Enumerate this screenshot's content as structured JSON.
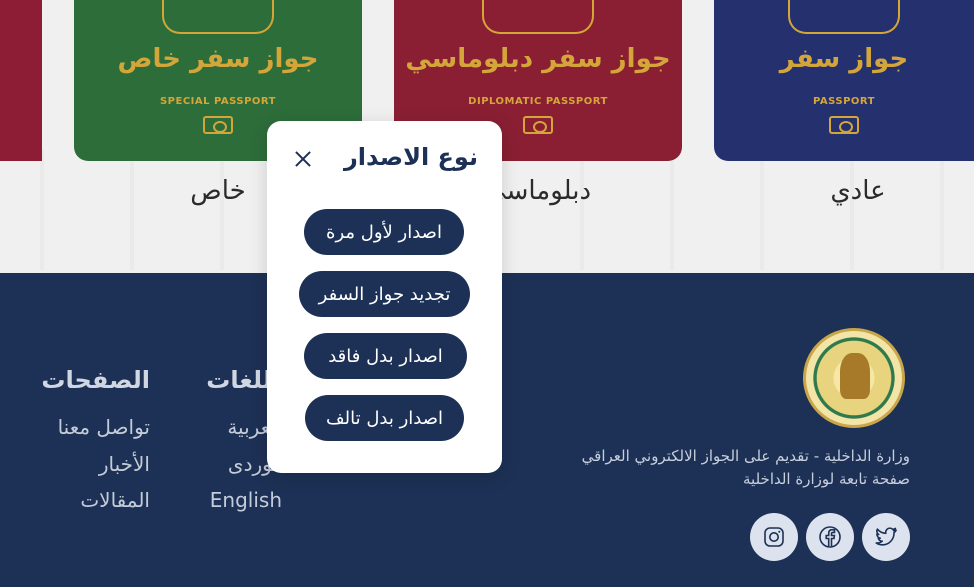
{
  "passports": [
    {
      "arabic": "جواز سفر خاص",
      "english": "SPECIAL PASSPORT",
      "caption": "خاص",
      "color": "#2d6d3a"
    },
    {
      "arabic": "جواز سفر دبلوماسي",
      "english": "DIPLOMATIC PASSPORT",
      "caption": "دبلوماسي",
      "color": "#8a1f33"
    },
    {
      "arabic": "جواز سفر",
      "english": "PASSPORT",
      "caption": "عادي",
      "color": "#25306e"
    }
  ],
  "modal": {
    "title": "نوع الاصدار",
    "options": [
      "اصدار لأول مرة",
      "تجديد جواز السفر",
      "اصدار بدل فاقد",
      "اصدار بدل تالف"
    ]
  },
  "footer": {
    "org_line_1": "وزارة الداخلية - تقديم على الجواز الالكتروني العراقي",
    "org_line_2": "صفحة تابعة لوزارة الداخلية",
    "pages_heading": "الصفحات",
    "pages": [
      "تواصل معنا",
      "الأخبار",
      "المقالات"
    ],
    "languages_heading": "اللغات",
    "languages": [
      "العربية",
      "كوردى",
      "English"
    ],
    "social_icons": [
      "twitter-icon",
      "facebook-icon",
      "instagram-icon"
    ]
  },
  "colors": {
    "navy": "#1d3156",
    "gold": "#d4a63a"
  }
}
